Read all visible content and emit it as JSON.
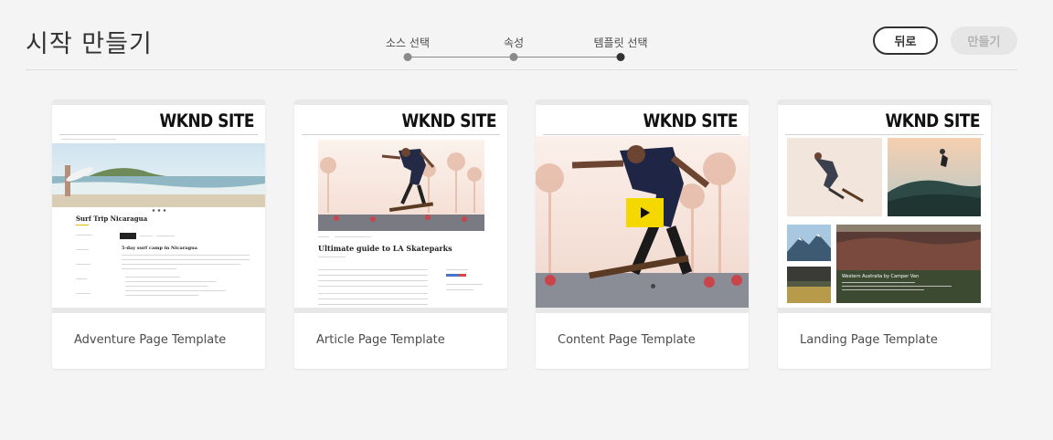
{
  "header": {
    "title": "시작 만들기",
    "back_label": "뒤로",
    "create_label": "만들기"
  },
  "steps": [
    {
      "label": "소스 선택",
      "state": "done"
    },
    {
      "label": "속성",
      "state": "done"
    },
    {
      "label": "템플릿 선택",
      "state": "current"
    }
  ],
  "templates": [
    {
      "name": "Adventure Page Template",
      "thumb": {
        "site": "WKND SITE",
        "heading": "Surf Trip Nicaragua",
        "subheading": "5-day surf camp in Nicaragua"
      }
    },
    {
      "name": "Article Page Template",
      "thumb": {
        "site": "WKND SITE",
        "heading": "Ultimate guide to LA Skateparks"
      }
    },
    {
      "name": "Content Page Template",
      "thumb": {
        "site": "WKND SITE"
      }
    },
    {
      "name": "Landing Page Template",
      "thumb": {
        "site": "WKND SITE",
        "caption": "Western Australia by Camper Van"
      }
    }
  ],
  "colors": {
    "accent": "#323232",
    "play": "#f5d800",
    "background": "#f4f4f4"
  }
}
